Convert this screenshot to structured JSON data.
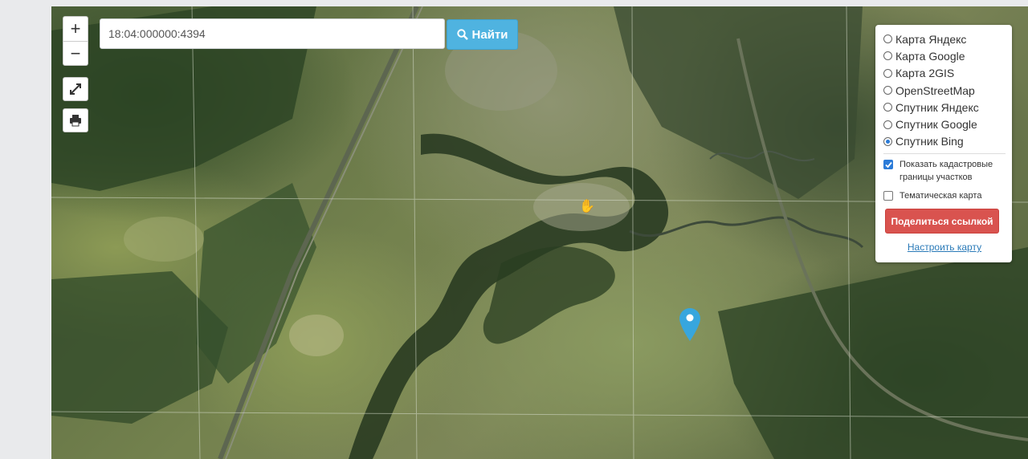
{
  "map": {
    "basemap_type": "satellite",
    "marker_color": "#37a6de"
  },
  "controls": {
    "zoom_in_label": "+",
    "zoom_out_label": "−",
    "fullscreen_icon": "expand-icon",
    "print_icon": "printer-icon"
  },
  "search": {
    "value": "18:04:000000:4394",
    "button_label": "Найти",
    "button_icon": "search-icon",
    "button_color": "#4fb3e0"
  },
  "layers": {
    "options": [
      {
        "label": "Карта Яндекс",
        "selected": false
      },
      {
        "label": "Карта Google",
        "selected": false
      },
      {
        "label": "Карта 2GIS",
        "selected": false
      },
      {
        "label": "OpenStreetMap",
        "selected": false
      },
      {
        "label": "Спутник Яндекс",
        "selected": false
      },
      {
        "label": "Спутник Google",
        "selected": false
      },
      {
        "label": "Спутник Bing",
        "selected": true
      }
    ],
    "checkboxes": [
      {
        "label": "Показать кадастровые границы участков",
        "checked": true
      },
      {
        "label": "Тематическая карта",
        "checked": false
      }
    ],
    "share_button_label": "Поделиться ссылкой",
    "share_button_color": "#d9534f",
    "configure_link": "Настроить карту"
  }
}
